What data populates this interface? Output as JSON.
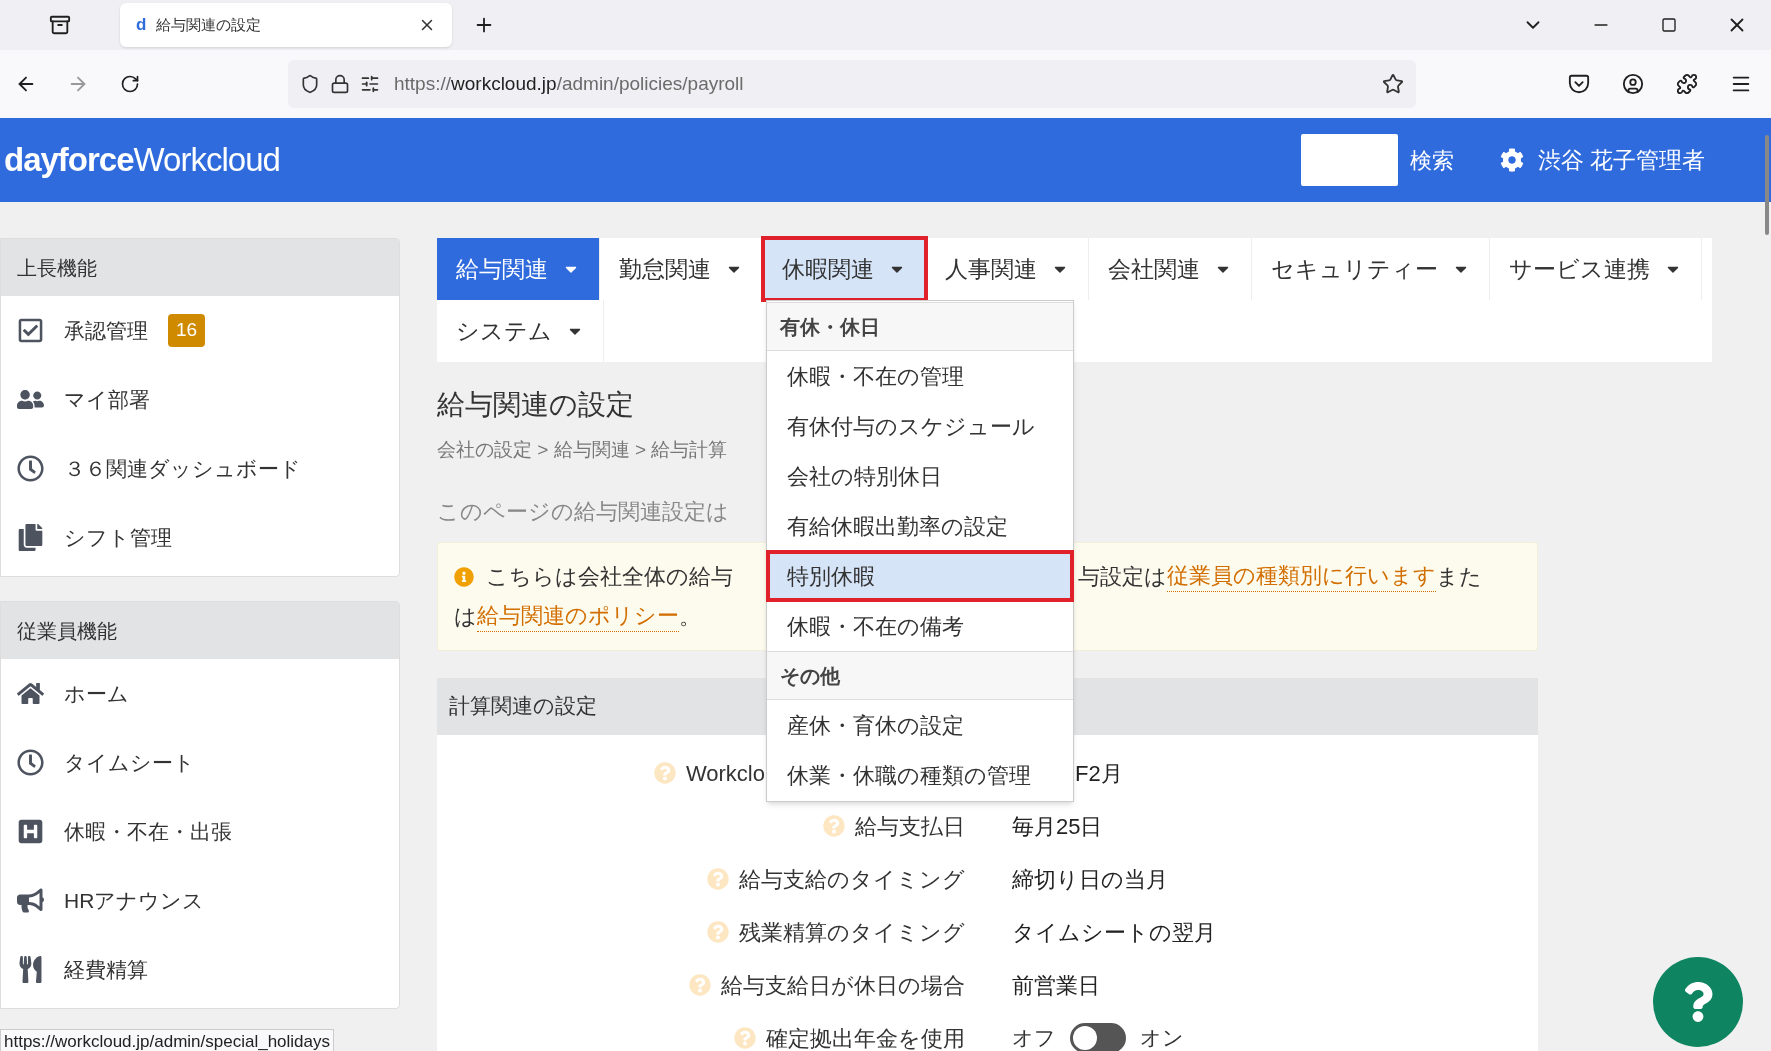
{
  "browser": {
    "tab_title": "給与関連の設定",
    "tab_favicon": "d",
    "url_host": "workcloud.jp",
    "url_scheme": "https://",
    "url_path": "/admin/policies/payroll"
  },
  "header": {
    "logo_bold": "dayforce",
    "logo_light": "Workcloud",
    "search_button": "検索",
    "user": "渋谷 花子管理者"
  },
  "sidebar": [
    {
      "title": "上長機能",
      "items": [
        {
          "label": "承認管理",
          "badge": "16"
        },
        {
          "label": "マイ部署"
        },
        {
          "label": "３６関連ダッシュボード"
        },
        {
          "label": "シフト管理"
        }
      ]
    },
    {
      "title": "従業員機能",
      "items": [
        {
          "label": "ホーム"
        },
        {
          "label": "タイムシート"
        },
        {
          "label": "休暇・不在・出張"
        },
        {
          "label": "HRアナウンス"
        },
        {
          "label": "経費精算"
        }
      ]
    }
  ],
  "nav_tabs": [
    {
      "label": "給与関連",
      "selected": true,
      "open": false
    },
    {
      "label": "勤怠関連",
      "selected": false,
      "open": false
    },
    {
      "label": "休暇関連",
      "selected": false,
      "open": true
    },
    {
      "label": "人事関連",
      "selected": false,
      "open": false
    },
    {
      "label": "会社関連",
      "selected": false,
      "open": false
    },
    {
      "label": "セキュリティー",
      "selected": false,
      "open": false
    },
    {
      "label": "サービス連携",
      "selected": false,
      "open": false
    },
    {
      "label": "システム",
      "selected": false,
      "open": false
    }
  ],
  "dropdown": [
    {
      "kind": "header",
      "label": "有休・休日"
    },
    {
      "kind": "item",
      "label": "休暇・不在の管理",
      "selected": false
    },
    {
      "kind": "item",
      "label": "有休付与のスケジュール",
      "selected": false
    },
    {
      "kind": "item",
      "label": "会社の特別休日",
      "selected": false
    },
    {
      "kind": "item",
      "label": "有給休暇出勤率の設定",
      "selected": false
    },
    {
      "kind": "item",
      "label": "特別休暇",
      "selected": true
    },
    {
      "kind": "item",
      "label": "休暇・不在の備考",
      "selected": false
    },
    {
      "kind": "header",
      "label": "その他"
    },
    {
      "kind": "item",
      "label": "産休・育休の設定",
      "selected": false
    },
    {
      "kind": "item",
      "label": "休業・休職の種類の管理",
      "selected": false
    }
  ],
  "page": {
    "title": "給与関連の設定",
    "breadcrumb": "会社の設定 > 給与関連 > 給与計算",
    "note": "このページの給与関連設定は",
    "info": {
      "part1": "こちらは会社全体の給与",
      "part2": "与設定は",
      "link1": "従業員の種類別に行います",
      "part3": "また",
      "part4": "は",
      "link2": "給与関連のポリシー",
      "part5": "。"
    },
    "section_title": "計算関連の設定",
    "rows": [
      {
        "kind": "partial",
        "label": "Workclo",
        "value": "F2月"
      },
      {
        "kind": "text",
        "label": "給与支払日",
        "value": "毎月25日"
      },
      {
        "kind": "text",
        "label": "給与支給のタイミング",
        "value": "締切り日の当月"
      },
      {
        "kind": "text",
        "label": "残業精算のタイミング",
        "value": "タイムシートの翌月"
      },
      {
        "kind": "text",
        "label": "給与支給日が休日の場合",
        "value": "前営業日"
      },
      {
        "kind": "toggle",
        "label": "確定拠出年金を使用",
        "off_label": "オフ",
        "on_label": "オン",
        "on": false
      }
    ]
  },
  "status_url": "https://workcloud.jp/admin/special_holidays"
}
